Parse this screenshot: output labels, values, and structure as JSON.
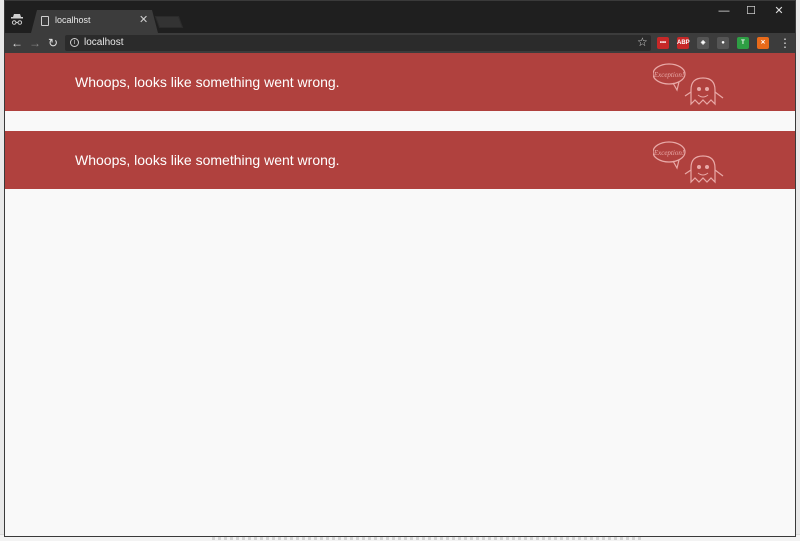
{
  "browser": {
    "tab_title": "localhost",
    "tab_close": "✕",
    "url": "localhost",
    "window_controls": {
      "minimize": "—",
      "maximize": "☐",
      "close": "✕"
    },
    "nav": {
      "back": "←",
      "forward": "→",
      "reload": "↻"
    },
    "star": "☆",
    "menu": "⋮",
    "extensions": [
      {
        "name": "ext-red-dots-icon",
        "label": "•••",
        "color": "#c62828"
      },
      {
        "name": "adblock-icon",
        "label": "ABP",
        "color": "#c62828"
      },
      {
        "name": "shield-icon",
        "label": "◈",
        "color": "#555555"
      },
      {
        "name": "ghost-ext-icon",
        "label": "●",
        "color": "#555555"
      },
      {
        "name": "t-extension-icon",
        "label": "T",
        "color": "#2e9e44"
      },
      {
        "name": "tools-extension-icon",
        "label": "✕",
        "color": "#e86a1a"
      }
    ]
  },
  "page": {
    "banners": [
      {
        "message": "Whoops, looks like something went wrong.",
        "logo_text": "Exception!"
      },
      {
        "message": "Whoops, looks like something went wrong.",
        "logo_text": "Exception!"
      }
    ],
    "colors": {
      "banner": "#b0413e",
      "background": "#f9f9f9"
    }
  }
}
